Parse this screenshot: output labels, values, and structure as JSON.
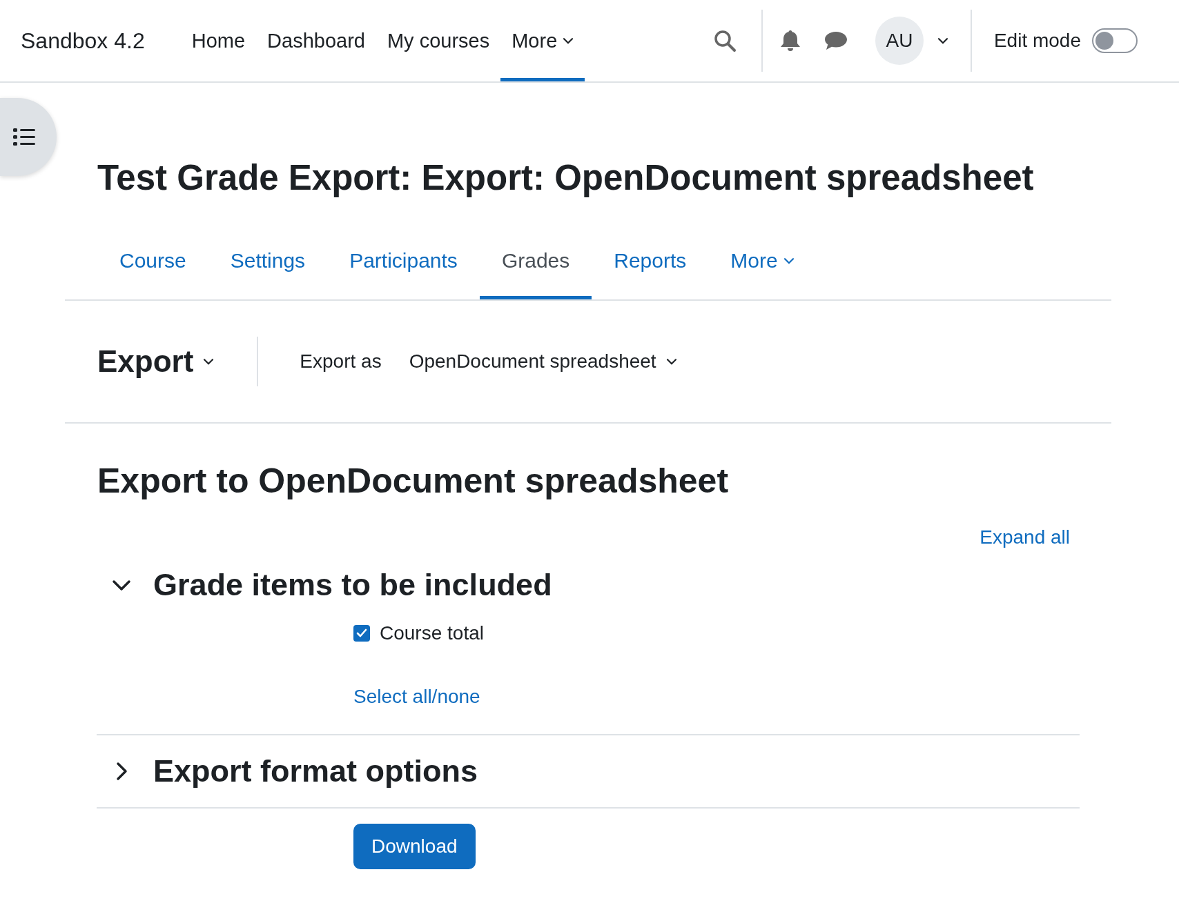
{
  "navbar": {
    "brand": "Sandbox 4.2",
    "items": [
      {
        "label": "Home",
        "selected": false,
        "dropdown": false
      },
      {
        "label": "Dashboard",
        "selected": false,
        "dropdown": false
      },
      {
        "label": "My courses",
        "selected": false,
        "dropdown": false
      },
      {
        "label": "More",
        "selected": true,
        "dropdown": true
      }
    ],
    "user_initials": "AU",
    "edit_mode": {
      "label": "Edit mode",
      "on": false
    }
  },
  "page_title": "Test Grade Export: Export: OpenDocument spreadsheet",
  "tabs": [
    {
      "label": "Course",
      "selected": false,
      "dropdown": false
    },
    {
      "label": "Settings",
      "selected": false,
      "dropdown": false
    },
    {
      "label": "Participants",
      "selected": false,
      "dropdown": false
    },
    {
      "label": "Grades",
      "selected": true,
      "dropdown": false
    },
    {
      "label": "Reports",
      "selected": false,
      "dropdown": false
    },
    {
      "label": "More",
      "selected": false,
      "dropdown": true
    }
  ],
  "tertiary": {
    "heading": "Export",
    "export_as_label": "Export as",
    "export_as_value": "OpenDocument spreadsheet"
  },
  "form": {
    "heading": "Export to OpenDocument spreadsheet",
    "expand_all": "Expand all",
    "sections": [
      {
        "title": "Grade items to be included",
        "expanded": true,
        "items": [
          {
            "label": "Course total",
            "checked": true
          }
        ],
        "select_all": "Select all/none"
      },
      {
        "title": "Export format options",
        "expanded": false
      }
    ],
    "submit": "Download"
  }
}
